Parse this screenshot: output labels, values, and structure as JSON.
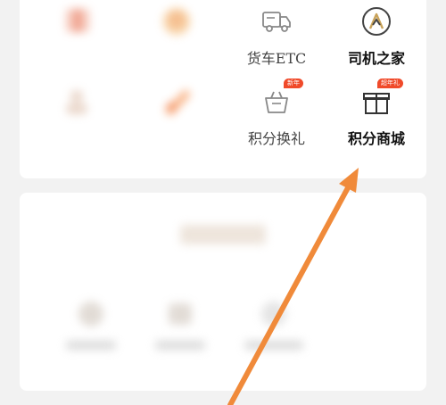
{
  "top_grid": {
    "row1": [
      {
        "label": "",
        "icon": "gift-box-icon",
        "blurred": true,
        "color": "#f3b8a7"
      },
      {
        "label": "",
        "icon": "coin-stack-icon",
        "blurred": true,
        "color": "#f6c58a"
      },
      {
        "label": "货车ETC",
        "icon": "truck-icon",
        "blurred": false
      },
      {
        "label": "司机之家",
        "icon": "driver-home-icon",
        "blurred": false
      }
    ],
    "row2": [
      {
        "label": "",
        "icon": "profile-icon",
        "blurred": true,
        "color": "#e3c9b8"
      },
      {
        "label": "",
        "icon": "promo-icon",
        "blurred": true,
        "color": "#f79a5e"
      },
      {
        "label": "积分换礼",
        "icon": "shopping-basket-icon",
        "blurred": false,
        "badge": "新年"
      },
      {
        "label": "积分商城",
        "icon": "gift-box-icon",
        "blurred": false,
        "badge": "超年礼"
      }
    ]
  },
  "bottom_section": {
    "title": "",
    "items": [
      {
        "label": "",
        "icon": "blurred-icon"
      },
      {
        "label": "",
        "icon": "blurred-icon"
      },
      {
        "label": "",
        "icon": "blurred-icon"
      }
    ]
  },
  "colors": {
    "accent": "#f07a2a",
    "badge": "#f04a2a",
    "arrow": "#f08a3a"
  }
}
